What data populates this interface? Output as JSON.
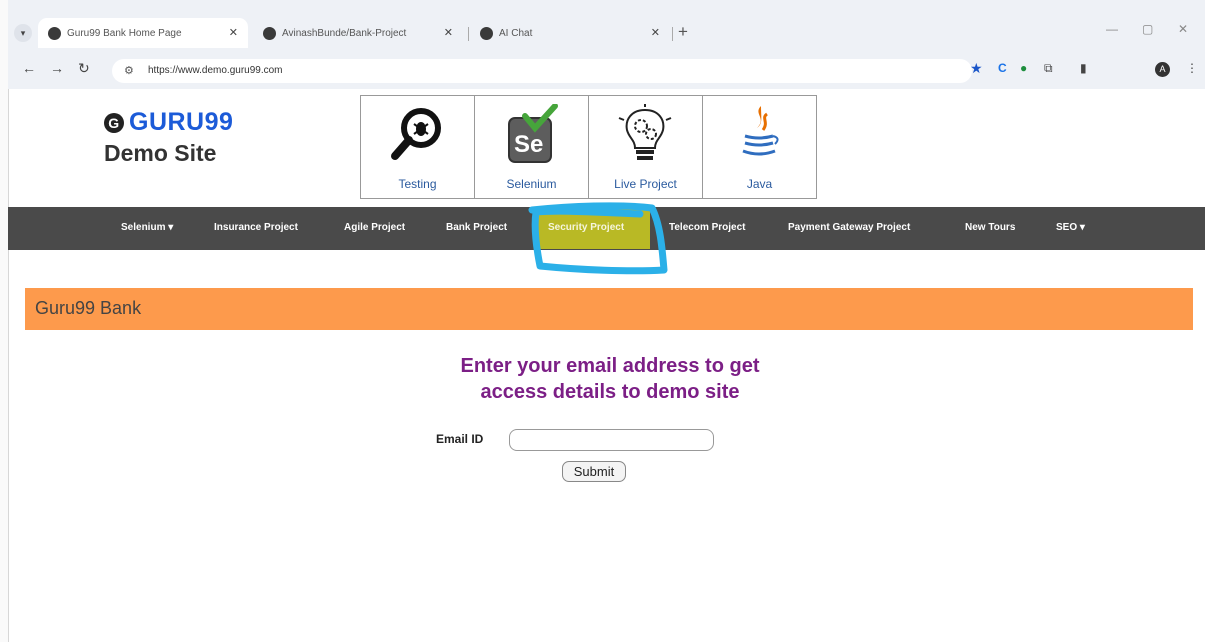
{
  "browser": {
    "tabs": [
      {
        "title": "Guru99 Bank Home Page",
        "active": true
      },
      {
        "title": "AvinashBunde/Bank-Project",
        "active": false
      },
      {
        "title": "AI Chat",
        "active": false
      }
    ],
    "url": "https://www.demo.guru99.com"
  },
  "logo": {
    "brand": "GURU99",
    "subtitle": "Demo Site"
  },
  "banner": [
    {
      "label": "Testing",
      "icon": "magnifier-bug-icon"
    },
    {
      "label": "Selenium",
      "icon": "selenium-icon"
    },
    {
      "label": "Live Project",
      "icon": "lightbulb-gears-icon"
    },
    {
      "label": "Java",
      "icon": "java-icon"
    }
  ],
  "nav": {
    "items": [
      "Selenium ▾",
      "Insurance Project",
      "Agile Project",
      "Bank Project",
      "Security Project",
      "Telecom Project",
      "Payment Gateway Project",
      "New Tours",
      "SEO ▾"
    ],
    "highlighted": "Security Project"
  },
  "bank_bar": {
    "title": "Guru99 Bank"
  },
  "form": {
    "heading_line1": "Enter your email address to get",
    "heading_line2": "access details to demo site",
    "email_label": "Email ID",
    "email_value": "",
    "submit_label": "Submit"
  },
  "colors": {
    "accent_orange": "#fd9a4c",
    "heading_purple": "#7c1f86",
    "nav_bg": "#4a4a4a",
    "highlight": "#cdcd1e",
    "scribble": "#2bb0e8"
  }
}
